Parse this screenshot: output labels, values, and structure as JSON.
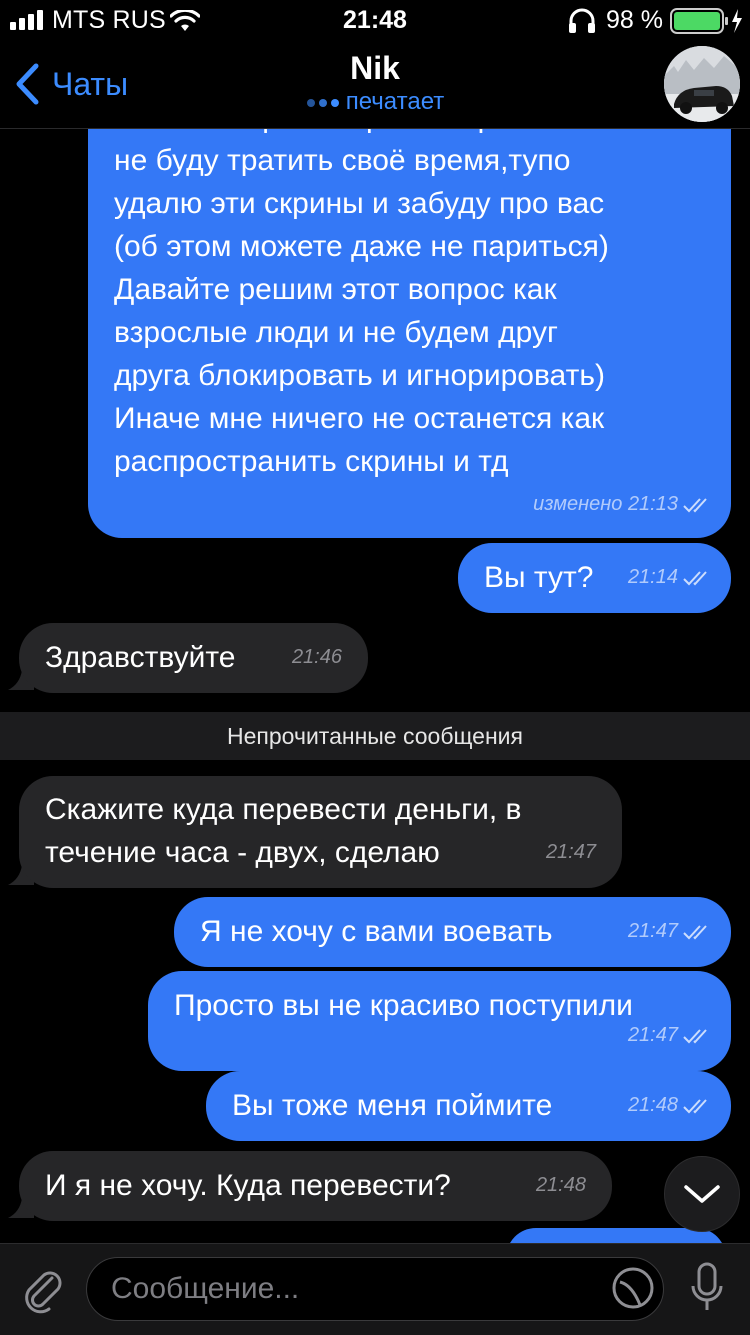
{
  "status_bar": {
    "carrier": "MTS RUS",
    "time": "21:48",
    "battery": "98 %"
  },
  "nav": {
    "back_label": "Чаты",
    "title": "Nik",
    "subtitle": "печатает"
  },
  "messages": [
    {
      "id": "m1",
      "dir": "out",
      "text": "Если выберете первый вариант то я\nне буду тратить своё время,тупо\nудалю эти скрины и забуду про вас\n(об этом можете даже не париться)\nДавайте решим этот вопрос как\nвзрослые люди и не будем друг\nдруга блокировать и игнорировать)\nИначе мне ничего не останется как\nраспространить скрины и тд",
      "meta": "изменено 21:13",
      "read": true
    },
    {
      "id": "m2",
      "dir": "out",
      "text": "Вы тут?",
      "meta": "21:14",
      "read": true
    },
    {
      "id": "m3",
      "dir": "in",
      "text": "Здравствуйте",
      "meta": "21:46"
    },
    {
      "id": "m4",
      "dir": "in",
      "text": "Скажите куда перевести деньги, в\nтечение часа - двух, сделаю",
      "meta": "21:47"
    },
    {
      "id": "m5",
      "dir": "out",
      "text": "Я не хочу с вами воевать",
      "meta": "21:47",
      "read": true
    },
    {
      "id": "m6",
      "dir": "out",
      "text": "Просто вы не красиво поступили",
      "meta": "21:47",
      "read": true
    },
    {
      "id": "m7",
      "dir": "out",
      "text": "Вы тоже меня поймите",
      "meta": "21:48",
      "read": true
    },
    {
      "id": "m8",
      "dir": "in",
      "text": "И я не хочу. Куда перевести?",
      "meta": "21:48"
    }
  ],
  "unread_divider": "Непрочитанные сообщения",
  "composer": {
    "placeholder": "Сообщение..."
  },
  "colors": {
    "outgoing": "#3478f6",
    "incoming": "#262628",
    "accent": "#3c8cff",
    "background": "#000000"
  },
  "icons": [
    "signal-icon",
    "wifi-icon",
    "headphones-icon",
    "battery-icon",
    "back-chevron-icon",
    "typing-dots-icon",
    "double-check-icon",
    "chevron-down-icon",
    "paperclip-icon",
    "sticker-icon",
    "microphone-icon"
  ]
}
